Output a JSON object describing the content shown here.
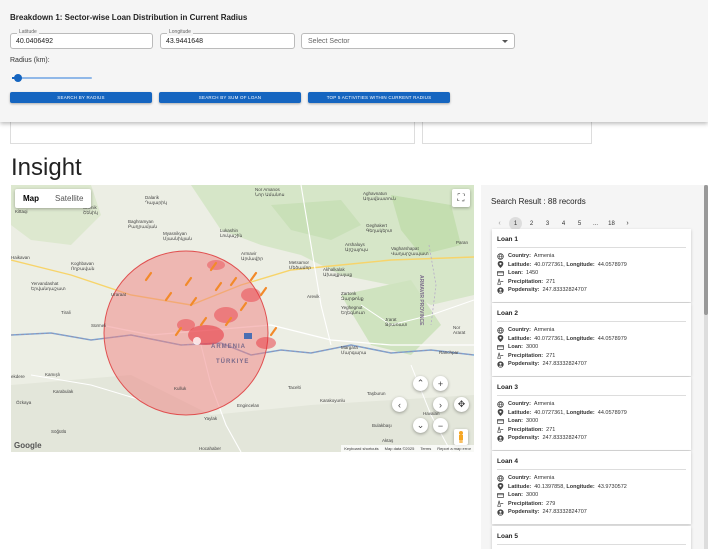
{
  "breakdown": {
    "title": "Breakdown 1: Sector-wise Loan Distribution in Current Radius",
    "latitude_label": "Latitude",
    "latitude_value": "40.0406492",
    "longitude_label": "Longitude",
    "longitude_value": "43.9441648",
    "sector_placeholder": "Select Sector",
    "radius_label": "Radius (km):",
    "radius_value_fraction": 0.08,
    "buttons": {
      "search_radius": "Search by Radius",
      "search_sum": "Search by Sum of Loan",
      "top5": "Top 5 Activities within Current Radius"
    }
  },
  "insight_title": "Insight",
  "map": {
    "tab_map": "Map",
    "tab_satellite": "Satellite",
    "country_label_1": "ARMENIA",
    "country_label_2": "TÜRKIYE",
    "province_label": "ARMAVIR PROVINCE",
    "places": {
      "nor_amanos": "Nor Amanos\nՆոր Ամանոս",
      "aghavnatun": "Aghavnatun\nԱղավնատուն",
      "karbi": "Karbi",
      "kosh": "Kosh",
      "dalarik": "Dalarik\nԴալարիկ",
      "shenik": "Shenik\nՇենիկ",
      "baghramyan": "Baghramyan\nԲաղրամյան",
      "myasnikyan": "Myasnikyan\nՄյասնիկյան",
      "lukashin": "Lukashin\nԼուկաշին",
      "geghakert": "Geghakert\nԳեղակերտ",
      "kittaqi": "Kittaqi",
      "haikavan": "Haikavan",
      "koghbavan": "Koghbavan\nՈղբավան",
      "armavir": "Armavir\nԱրմավիր",
      "metsamor": "Metsamor\nՄեծամոր",
      "arshaluys": "Arshaluys\nԱրշալույս",
      "vagharshapat": "Vagharshapat\nՎաղարշապատ",
      "yervandashat": "Yervandashat\nԵրվանդաշատ",
      "margara_top": "Margara",
      "akhalkalak": "Akhalkalak\nԱխալքալաք",
      "urarat": "Uraraat",
      "arevik": "Arevik",
      "zartonk": "Zartonk\nԶարթոնք",
      "yeghegnut": "Yeghegnut\nԵղեգնուտ",
      "tirali": "Tirali",
      "surmeli": "Sürmeli",
      "jrarat": "Jrarat\nՋրառատ",
      "margara": "Margara\nՄարգարա",
      "ranchpar": "Ranchpar",
      "ekdere": "ekdere",
      "kamisli": "Kamışlı",
      "karabulak": "Karabulak",
      "ozkaya": "Özkaya",
      "sogutlu": "Söğütlü",
      "tacalti": "Tacelti",
      "karakoyunlu": "Karakoyunlu",
      "tasburun": "Taşburun",
      "haval": "Havalan",
      "engincelan": "Engincelan",
      "kulluk": "Kulluk",
      "yaylak": "Yaylak",
      "bulakbasi": "Bulakbaşı",
      "aktas": "Aktaş",
      "hocahaber": "Hocahaber",
      "nor_ararat": "Nor\nArarat",
      "paran": "Paran"
    },
    "footer": {
      "shortcuts": "Keyboard shortcuts",
      "data": "Map data ©2025",
      "terms": "Terms",
      "report": "Report a map error"
    },
    "google": "Google",
    "colors": {
      "circle": "#f08080",
      "heat": "#e8323c",
      "marker": "#f28a2a"
    }
  },
  "results": {
    "title": "Search Result : 88 records",
    "pages": [
      "1",
      "2",
      "3",
      "4",
      "5",
      "...",
      "18"
    ],
    "labels": {
      "country": "Country:",
      "latitude": "Latitude:",
      "longitude": "Longitude:",
      "loan": "Loan:",
      "precipitation": "Precipitation:",
      "popdensity": "Popdensity:"
    },
    "loans": [
      {
        "title": "Loan 1",
        "country": "Armenia",
        "latitude": "40.0727361,",
        "longitude": "44.0578979",
        "loan": "1450",
        "precipitation": "271",
        "popdensity": "247.83332824707"
      },
      {
        "title": "Loan 2",
        "country": "Armenia",
        "latitude": "40.0727361,",
        "longitude": "44.0578979",
        "loan": "3000",
        "precipitation": "271",
        "popdensity": "247.83332824707"
      },
      {
        "title": "Loan 3",
        "country": "Armenia",
        "latitude": "40.0727361,",
        "longitude": "44.0578979",
        "loan": "3000",
        "precipitation": "271",
        "popdensity": "247.83332824707"
      },
      {
        "title": "Loan 4",
        "country": "Armenia",
        "latitude": "40.1397858,",
        "longitude": "43.9730572",
        "loan": "3000",
        "precipitation": "279",
        "popdensity": "247.83332824707"
      },
      {
        "title": "Loan 5"
      }
    ]
  }
}
